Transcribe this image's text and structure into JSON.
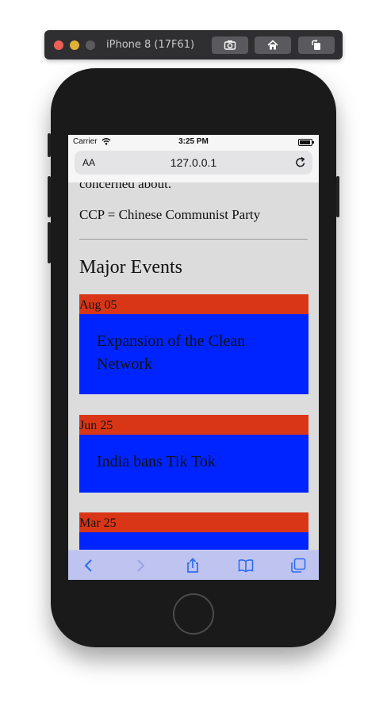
{
  "simulator": {
    "title": "iPhone 8 (17F61)"
  },
  "status_bar": {
    "carrier": "Carrier",
    "time": "3:25 PM"
  },
  "address_bar": {
    "text_size_label": "AA",
    "url": "127.0.0.1"
  },
  "content": {
    "cut_text": "concerned about.",
    "ccp_note": "CCP = Chinese Communist Party",
    "section_heading": "Major Events",
    "events": [
      {
        "date": "Aug 05",
        "title": "Expansion of the Clean Network"
      },
      {
        "date": "Jun 25",
        "title": "India bans Tik Tok"
      },
      {
        "date": "Mar 25",
        "title": ""
      }
    ]
  },
  "colors": {
    "date_bar": "#d93618",
    "event_body": "#0024ff",
    "page_bg": "#dcdcdc",
    "toolbar_bg": "#bec4ef"
  },
  "toolbar": {
    "icons": [
      "back-icon",
      "forward-icon",
      "share-icon",
      "bookmarks-icon",
      "tabs-icon"
    ]
  }
}
